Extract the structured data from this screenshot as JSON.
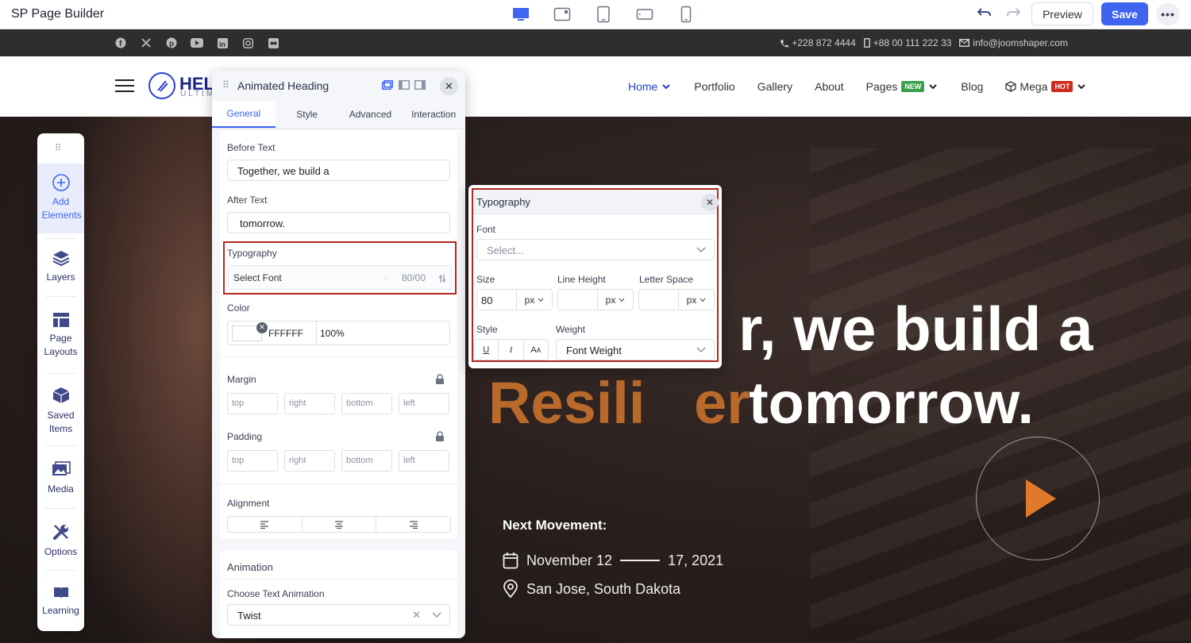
{
  "builder": {
    "title": "SP Page Builder",
    "preview_label": "Preview",
    "save_label": "Save",
    "more_label": "•••",
    "accent": "#3e64f0"
  },
  "site": {
    "phone1": "+228 872 4444",
    "phone2": "+88 00 111 222 33",
    "email": "info@joomshaper.com",
    "logo_text": "HEL",
    "logo_sub": "ULTIM",
    "menu": [
      {
        "label": "Home"
      },
      {
        "label": "Portfolio"
      },
      {
        "label": "Gallery"
      },
      {
        "label": "About"
      },
      {
        "label": "Pages",
        "badge": "NEW"
      },
      {
        "label": "Blog"
      },
      {
        "label": "Mega",
        "badge": "HOT"
      }
    ]
  },
  "hero": {
    "line1": "r, we build a",
    "animated_word": "Resili   er",
    "after": "tomorrow.",
    "next_title": "Next Movement:",
    "date_start": "November 12",
    "date_end": "17, 2021",
    "place": "San Jose, South Dakota"
  },
  "sidebar": {
    "items": [
      {
        "label": "Add Elements",
        "icon": "plus-circle-icon"
      },
      {
        "label": "Layers",
        "icon": "layers-icon"
      },
      {
        "label": "Page Layouts",
        "icon": "layout-icon"
      },
      {
        "label": "Saved Items",
        "icon": "box-icon"
      },
      {
        "label": "Media",
        "icon": "media-icon"
      },
      {
        "label": "Options",
        "icon": "wrench-icon"
      },
      {
        "label": "Learning",
        "icon": "book-icon"
      }
    ]
  },
  "panel": {
    "title": "Animated Heading",
    "tabs": [
      "General",
      "Style",
      "Advanced",
      "Interaction"
    ],
    "before_text_label": "Before Text",
    "before_text_value": "Together, we build a",
    "after_text_label": "After Text",
    "after_text_value": "tomorrow.",
    "typography_label": "Typography",
    "select_font": "Select Font",
    "font_dot": "·",
    "font_size_summary": "80/00",
    "color_label": "Color",
    "color_hex": "FFFFFF",
    "color_opacity": "100%",
    "margin_label": "Margin",
    "padding_label": "Padding",
    "side_placeholders": [
      "top",
      "right",
      "bottom",
      "left"
    ],
    "alignment_label": "Alignment",
    "animation_label": "Animation",
    "choose_anim_label": "Choose Text Animation",
    "anim_value": "Twist"
  },
  "typography_popup": {
    "title": "Typography",
    "font_label": "Font",
    "font_placeholder": "Select...",
    "size_label": "Size",
    "size_value": "80",
    "line_height_label": "Line Height",
    "letter_space_label": "Letter Space",
    "unit": "px",
    "style_label": "Style",
    "weight_label": "Weight",
    "weight_placeholder": "Font Weight",
    "style_buttons": [
      "U",
      "I",
      "Aᴀ"
    ]
  }
}
